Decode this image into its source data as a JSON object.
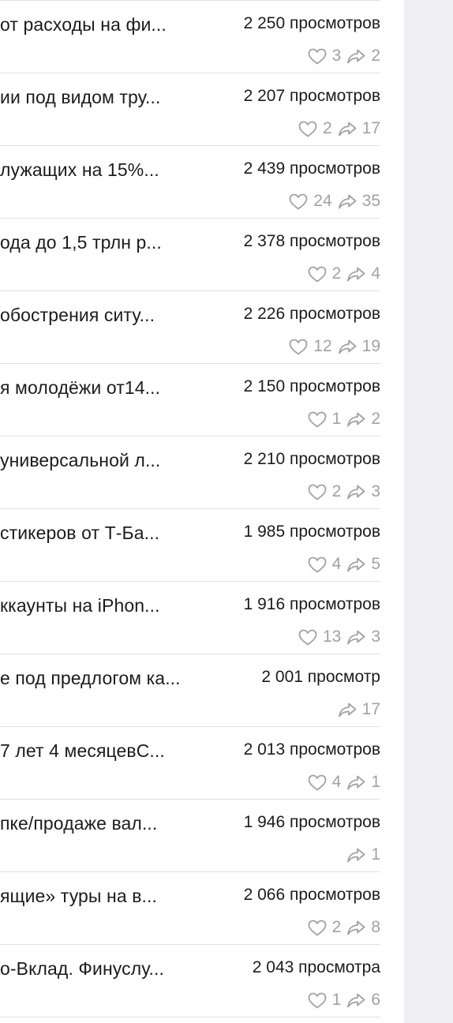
{
  "posts": [
    {
      "title": "от расходы на фи...",
      "views": "2 250 просмотров",
      "likes": "3",
      "shares": "2"
    },
    {
      "title": "ии под видом тру...",
      "views": "2 207 просмотров",
      "likes": "2",
      "shares": "17"
    },
    {
      "title": "лужащих на 15%...",
      "views": "2 439 просмотров",
      "likes": "24",
      "shares": "35"
    },
    {
      "title": "ода до 1,5 трлн р...",
      "views": "2 378 просмотров",
      "likes": "2",
      "shares": "4"
    },
    {
      "title": "обострения ситу...",
      "views": "2 226 просмотров",
      "likes": "12",
      "shares": "19"
    },
    {
      "title": "я молодёжи от14...",
      "views": "2 150 просмотров",
      "likes": "1",
      "shares": "2"
    },
    {
      "title": "универсальной л...",
      "views": "2 210 просмотров",
      "likes": "2",
      "shares": "3"
    },
    {
      "title": "стикеров от Т-Ба...",
      "views": "1 985 просмотров",
      "likes": "4",
      "shares": "5"
    },
    {
      "title": "ккаунты на iPhon...",
      "views": "1 916 просмотров",
      "likes": "13",
      "shares": "3"
    },
    {
      "title": "е под предлогом ка...",
      "views": "2 001 просмотр",
      "likes": null,
      "shares": "17"
    },
    {
      "title": "7 лет 4 месяцевС...",
      "views": "2 013 просмотров",
      "likes": "4",
      "shares": "1"
    },
    {
      "title": "пке/продаже вал...",
      "views": "1 946 просмотров",
      "likes": null,
      "shares": "1"
    },
    {
      "title": "ящие» туры на в...",
      "views": "2 066 просмотров",
      "likes": "2",
      "shares": "8"
    },
    {
      "title": "о-Вклад. Финуслу...",
      "views": "2 043 просмотра",
      "likes": "1",
      "shares": "6"
    }
  ],
  "icons": {
    "like": "heart-icon",
    "share": "share-arrow-icon"
  },
  "colors": {
    "text": "#1c1c1e",
    "muted": "#a1a1a8",
    "divider": "#e1e1e6",
    "sidebar": "#f0f0f4"
  }
}
